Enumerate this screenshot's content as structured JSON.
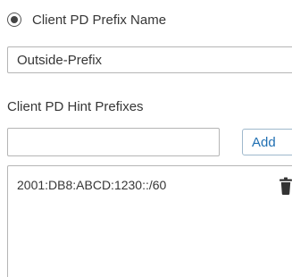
{
  "radio_option": {
    "label": "Client PD Prefix Name",
    "selected": true
  },
  "prefix_name_input": {
    "value": "Outside-Prefix"
  },
  "hint_prefixes": {
    "label": "Client PD Hint Prefixes",
    "input_value": "",
    "add_label": "Add",
    "items": [
      {
        "value": "2001:DB8:ABCD:1230::/60",
        "icon": "trash-icon"
      }
    ]
  },
  "colors": {
    "text": "#363636",
    "border": "#b5b5b5",
    "add_button_text": "#1f6fb2",
    "add_button_border": "#9fb8cc",
    "icon": "#333333"
  }
}
